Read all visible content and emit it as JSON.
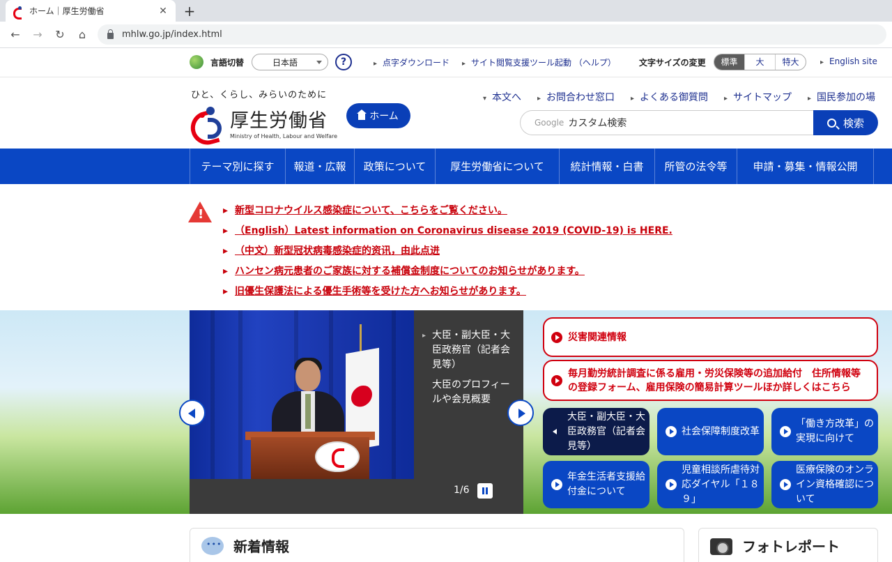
{
  "browser": {
    "tab_title": "ホーム｜厚生労働省",
    "url": "mhlw.go.jp/index.html"
  },
  "utility": {
    "lang_label": "言語切替",
    "lang_value": "日本語",
    "help": "?",
    "links": [
      "点字ダウンロード",
      "サイト閲覧支援ツール起動 （ヘルプ）"
    ],
    "fontsize_label": "文字サイズの変更",
    "fontsize_options": [
      "標準",
      "大",
      "特大"
    ],
    "english": "English site"
  },
  "header": {
    "tagline": "ひと、くらし、みらいのために",
    "logo_jp": "厚生労働省",
    "logo_en": "Ministry of Health, Labour and Welfare",
    "home": "ホーム",
    "links": [
      "本文へ",
      "お問合わせ窓口",
      "よくある御質問",
      "サイトマップ",
      "国民参加の場"
    ],
    "search_brand": "Google",
    "search_placeholder": "カスタム検索",
    "search_button": "検索"
  },
  "gnav": [
    "テーマ別に探す",
    "報道・広報",
    "政策について",
    "厚生労働省について",
    "統計情報・白書",
    "所管の法令等",
    "申請・募集・情報公開"
  ],
  "alerts": [
    "新型コロナウイルス感染症について、こちらをご覧ください。",
    "（English）Latest information on Coronavirus disease 2019 (COVID-19) is HERE.",
    "（中文）新型冠状病毒感染症的资讯，由此点进",
    "ハンセン病元患者のご家族に対する補償金制度についてのお知らせがあります。",
    "旧優生保護法による優生手術等を受けた方へお知らせがあります。"
  ],
  "slide": {
    "caption_title": "大臣・副大臣・大臣政務官（記者会見等）",
    "caption_sub": "大臣のプロフィールや会見概要",
    "counter": "1/6"
  },
  "redboxes": [
    "災害関連情報",
    "毎月勤労統計調査に係る雇用・労災保険等の追加給付　住所情報等の登録フォーム、雇用保険の簡易計算ツールほか詳しくはこちら"
  ],
  "tiles": [
    "大臣・副大臣・大臣政務官（記者会見等）",
    "社会保障制度改革",
    "「働き方改革」の実現に向けて",
    "年金生活者支援給付金について",
    "児童相談所虐待対応ダイヤル「１８９」",
    "医療保険のオンライン資格確認について"
  ],
  "panels": {
    "news": "新着情報",
    "photo": "フォトレポート"
  }
}
